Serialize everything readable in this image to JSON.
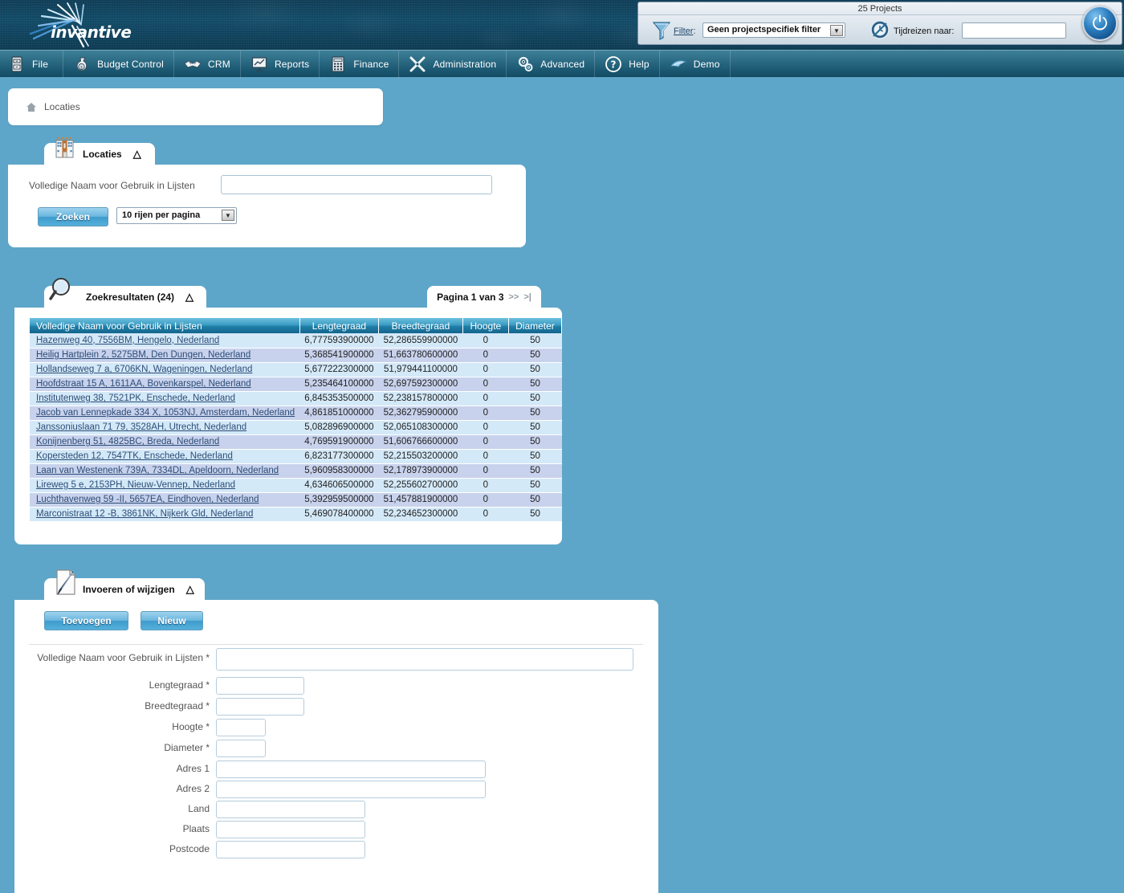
{
  "brand": {
    "name": "invantive",
    "accent": "#1d5a74",
    "page_bg": "#5ea6c9"
  },
  "topbar": {
    "projects_count": "25 Projects",
    "filter_icon": "funnel-icon",
    "filter_label": "Filter",
    "filter_colon": ":",
    "filter_value": "Geen projectspecifiek filter",
    "clock_icon": "time-travel-clock-icon",
    "timetravel_label": "Tijdreizen naar:",
    "timetravel_value": "",
    "power_icon": "power-icon"
  },
  "menu": {
    "items": [
      {
        "label": "File",
        "icon": "file-cabinet-icon"
      },
      {
        "label": "Budget Control",
        "icon": "money-bag-icon"
      },
      {
        "label": "CRM",
        "icon": "handshake-icon"
      },
      {
        "label": "Reports",
        "icon": "presentation-chart-icon"
      },
      {
        "label": "Finance",
        "icon": "calculator-icon"
      },
      {
        "label": "Administration",
        "icon": "tools-wrench-icon"
      },
      {
        "label": "Advanced",
        "icon": "gears-icon"
      },
      {
        "label": "Help",
        "icon": "question-mark-icon"
      },
      {
        "label": "Demo",
        "icon": "dolphin-logo-icon"
      }
    ]
  },
  "breadcrumb": {
    "home_icon": "home-icon",
    "text": "Locaties"
  },
  "search_panel": {
    "icon": "building-icon",
    "title": "Locaties",
    "collapse_icon": "chevron-up-icon",
    "field_label": "Volledige Naam voor Gebruik in Lijsten",
    "field_value": "",
    "search_button": "Zoeken",
    "rows_per_page": "10 rijen per pagina"
  },
  "results_panel": {
    "icon": "magnifier-icon",
    "title": "Zoekresultaten (24)",
    "collapse_icon": "chevron-up-icon",
    "paging_text": "Pagina 1 van 3",
    "paging_next": ">>",
    "paging_last": ">|",
    "columns": [
      "Volledige Naam voor Gebruik in Lijsten",
      "Lengtegraad",
      "Breedtegraad",
      "Hoogte",
      "Diameter"
    ],
    "rows": [
      {
        "naam": "Hazenweg 40, 7556BM, Hengelo, Nederland",
        "lengtegraad": "6,777593900000",
        "breedtegraad": "52,286559900000",
        "hoogte": "0",
        "diameter": "50"
      },
      {
        "naam": "Heilig Hartplein 2, 5275BM, Den Dungen, Nederland",
        "lengtegraad": "5,368541900000",
        "breedtegraad": "51,663780600000",
        "hoogte": "0",
        "diameter": "50"
      },
      {
        "naam": "Hollandseweg 7 a, 6706KN, Wageningen, Nederland",
        "lengtegraad": "5,677222300000",
        "breedtegraad": "51,979441100000",
        "hoogte": "0",
        "diameter": "50"
      },
      {
        "naam": "Hoofdstraat 15 A, 1611AA, Bovenkarspel, Nederland ",
        "lengtegraad": "5,235464100000",
        "breedtegraad": "52,697592300000",
        "hoogte": "0",
        "diameter": "50"
      },
      {
        "naam": "Institutenweg 38, 7521PK, Enschede, Nederland",
        "lengtegraad": "6,845353500000",
        "breedtegraad": "52,238157800000",
        "hoogte": "0",
        "diameter": "50"
      },
      {
        "naam": "Jacob van Lennepkade 334 X, 1053NJ, Amsterdam, Nederland ",
        "lengtegraad": "4,861851000000",
        "breedtegraad": "52,362795900000",
        "hoogte": "0",
        "diameter": "50"
      },
      {
        "naam": "Janssoniuslaan 71 79, 3528AH, Utrecht, Nederland",
        "lengtegraad": "5,082896900000",
        "breedtegraad": "52,065108300000",
        "hoogte": "0",
        "diameter": "50"
      },
      {
        "naam": "Konijnenberg 51, 4825BC, Breda, Nederland",
        "lengtegraad": "4,769591900000",
        "breedtegraad": "51,606766600000",
        "hoogte": "0",
        "diameter": "50"
      },
      {
        "naam": "Kopersteden 12, 7547TK, Enschede, Nederland",
        "lengtegraad": "6,823177300000",
        "breedtegraad": "52,215503200000",
        "hoogte": "0",
        "diameter": "50"
      },
      {
        "naam": "Laan van Westenenk 739A, 7334DL, Apeldoorn, Nederland ",
        "lengtegraad": "5,960958300000",
        "breedtegraad": "52,178973900000",
        "hoogte": "0",
        "diameter": "50"
      },
      {
        "naam": "Lireweg 5 e, 2153PH, Nieuw-Vennep, Nederland",
        "lengtegraad": "4,634606500000",
        "breedtegraad": "52,255602700000",
        "hoogte": "0",
        "diameter": "50"
      },
      {
        "naam": "Luchthavenweg 59 -II, 5657EA, Eindhoven, Nederland",
        "lengtegraad": "5,392959500000",
        "breedtegraad": "51,457881900000",
        "hoogte": "0",
        "diameter": "50"
      },
      {
        "naam": "Marconistraat 12 -B, 3861NK, Nijkerk Gld, Nederland",
        "lengtegraad": "5,469078400000",
        "breedtegraad": "52,234652300000",
        "hoogte": "0",
        "diameter": "50"
      }
    ]
  },
  "edit_panel": {
    "icon": "pencil-note-icon",
    "title": "Invoeren of wijzigen",
    "collapse_icon": "chevron-up-icon",
    "add_button": "Toevoegen",
    "new_button": "Nieuw",
    "fields": [
      {
        "label": "Volledige Naam voor Gebruik in Lijsten *",
        "value": "",
        "name": "volledige-naam"
      },
      {
        "label": "Lengtegraad *",
        "value": "",
        "name": "lengtegraad"
      },
      {
        "label": "Breedtegraad *",
        "value": "",
        "name": "breedtegraad"
      },
      {
        "label": "Hoogte *",
        "value": "",
        "name": "hoogte"
      },
      {
        "label": "Diameter *",
        "value": "",
        "name": "diameter"
      },
      {
        "label": "Adres 1",
        "value": "",
        "name": "adres-1"
      },
      {
        "label": "Adres 2",
        "value": "",
        "name": "adres-2"
      },
      {
        "label": "Land",
        "value": "",
        "name": "land"
      },
      {
        "label": "Plaats",
        "value": "",
        "name": "plaats"
      },
      {
        "label": "Postcode",
        "value": "",
        "name": "postcode"
      }
    ]
  }
}
